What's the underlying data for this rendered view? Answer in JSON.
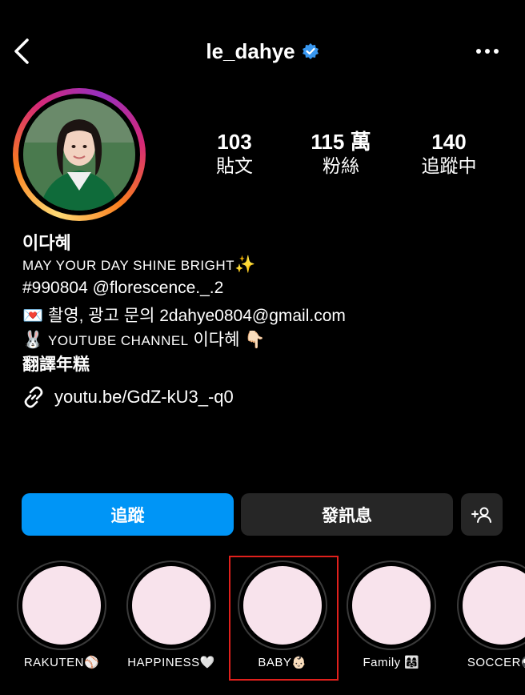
{
  "header": {
    "username": "le_dahye",
    "verified_icon": "verified-badge-icon",
    "back_icon": "chevron-left-icon",
    "more_icon": "more-horizontal-icon"
  },
  "stats": [
    {
      "value": "103",
      "label": "貼文"
    },
    {
      "value": "115 萬",
      "label": "粉絲"
    },
    {
      "value": "140",
      "label": "追蹤中"
    }
  ],
  "bio": {
    "name": "이다혜",
    "line1": "MAY YOUR DAY SHINE BRIGHT",
    "line1_emoji": "✨",
    "line2": "#990804 @florescence._.2",
    "line3_emoji": "💌",
    "line3": "촬영, 광고 문의 2dahye0804@gmail.com",
    "line4_emoji": "🐰",
    "line4_caps": "YOUTUBE CHANNEL",
    "line4_rest": "이다혜",
    "line4_end_emoji": "👇🏻",
    "translate": "翻譯年糕",
    "link": "youtu.be/GdZ-kU3_-q0"
  },
  "buttons": {
    "follow": "追蹤",
    "message": "發訊息",
    "add_user_icon": "add-user-icon"
  },
  "highlights": [
    {
      "label": "RAKUTEN⚾️"
    },
    {
      "label": "HAPPINESS🤍"
    },
    {
      "label": "BABY👶🏻"
    },
    {
      "label": "Family 👩‍👩‍👧"
    },
    {
      "label": "SOCCER⚽"
    }
  ],
  "colors": {
    "accent": "#0095f6",
    "highlight_fill": "#f8e3ec",
    "selection_box": "#e0201c"
  }
}
